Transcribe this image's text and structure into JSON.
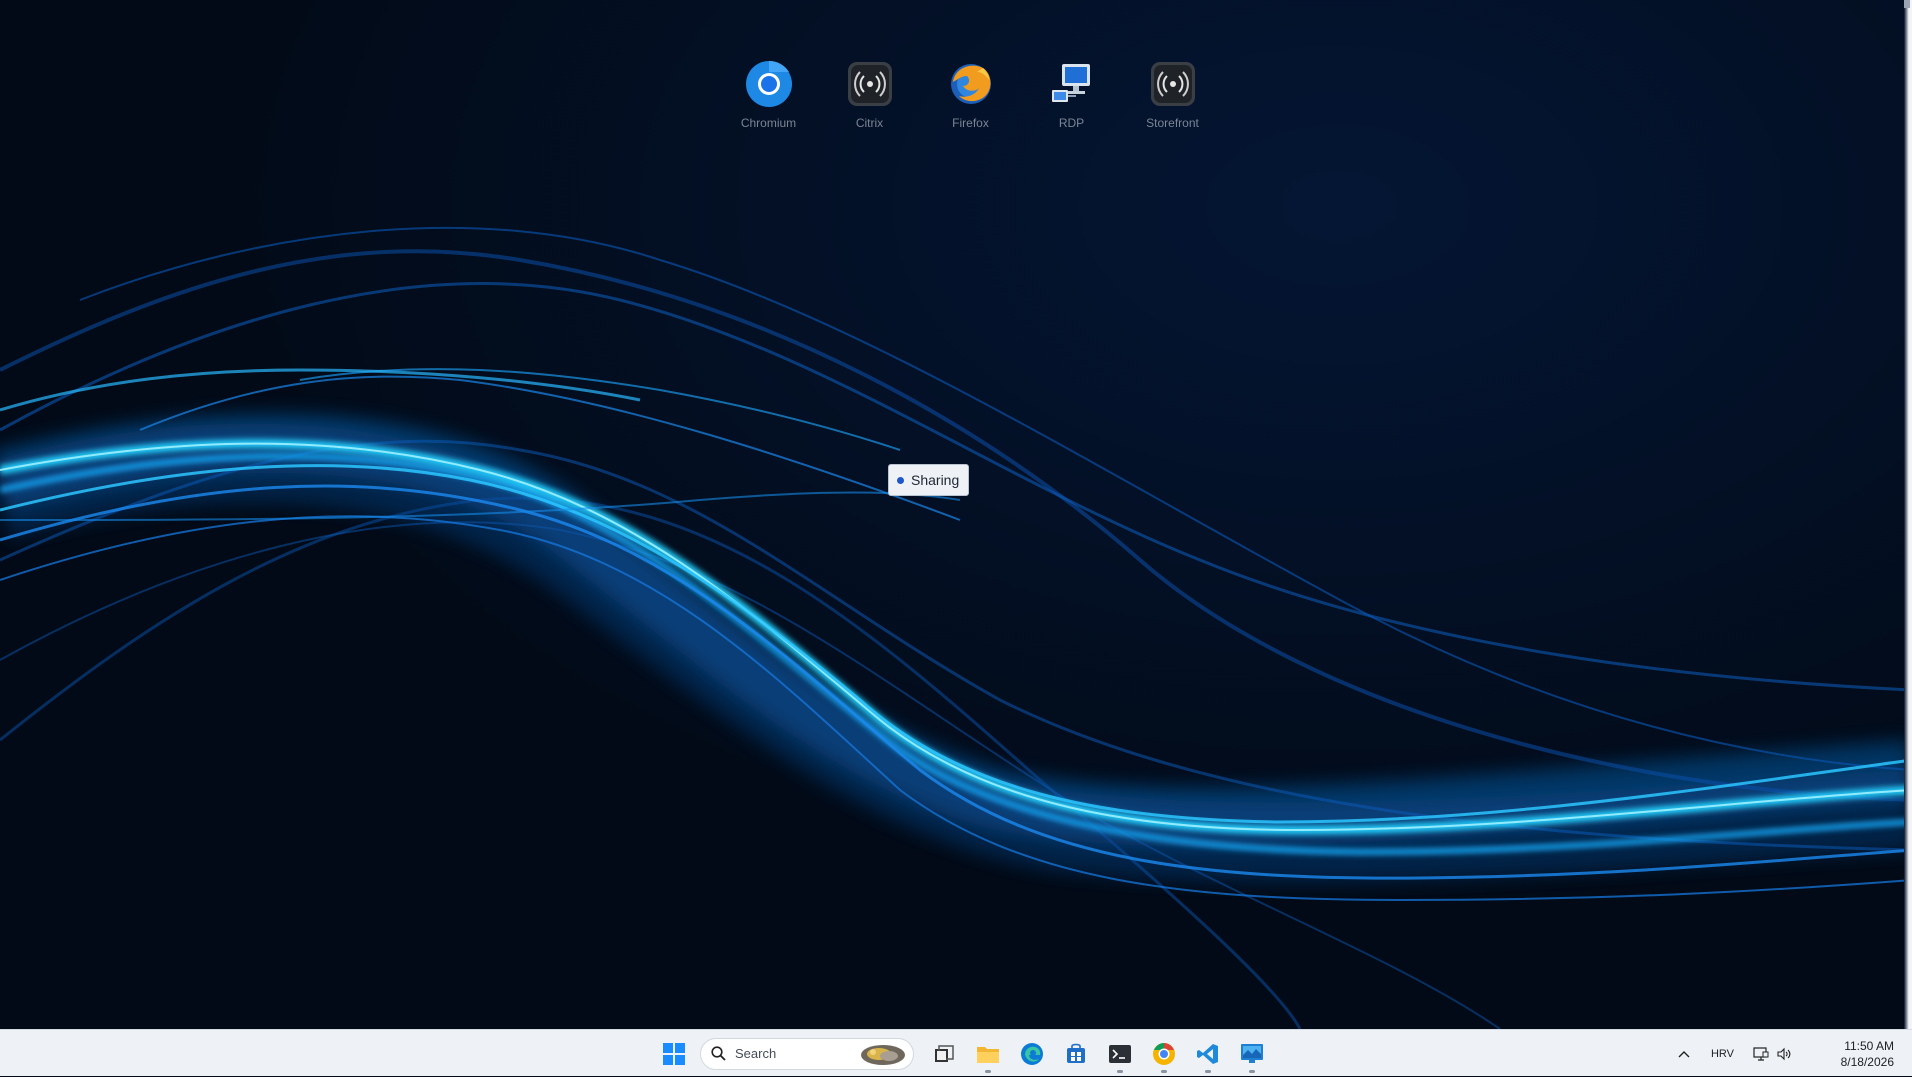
{
  "desktop": {
    "apps": [
      {
        "label": "Chromium",
        "icon": "chromium-icon"
      },
      {
        "label": "Citrix",
        "icon": "citrix-icon"
      },
      {
        "label": "Firefox",
        "icon": "firefox-icon"
      },
      {
        "label": "RDP",
        "icon": "rdp-icon"
      },
      {
        "label": "Storefront",
        "icon": "storefront-icon"
      }
    ],
    "sharing_label": "Sharing",
    "sharing_color": "#1e57c8"
  },
  "taskbar": {
    "search_placeholder": "Search",
    "pinned": [
      {
        "icon": "task-view-icon",
        "running": false
      },
      {
        "icon": "file-explorer-icon",
        "running": true
      },
      {
        "icon": "edge-icon",
        "running": false
      },
      {
        "icon": "store-icon",
        "running": false
      },
      {
        "icon": "terminal-icon",
        "running": true
      },
      {
        "icon": "chromium-icon",
        "running": true
      },
      {
        "icon": "vscode-icon",
        "running": true
      },
      {
        "icon": "remote-desktop-icon",
        "running": true
      }
    ],
    "language": "HRV",
    "time": "11:50 AM",
    "date": "8/18/2026"
  },
  "colors": {
    "wallpaper_dark": "#020a17",
    "wave_bright": "#22d4ff",
    "wave_mid": "#1a7fe6",
    "taskbar_bg": "#eef1f6"
  }
}
